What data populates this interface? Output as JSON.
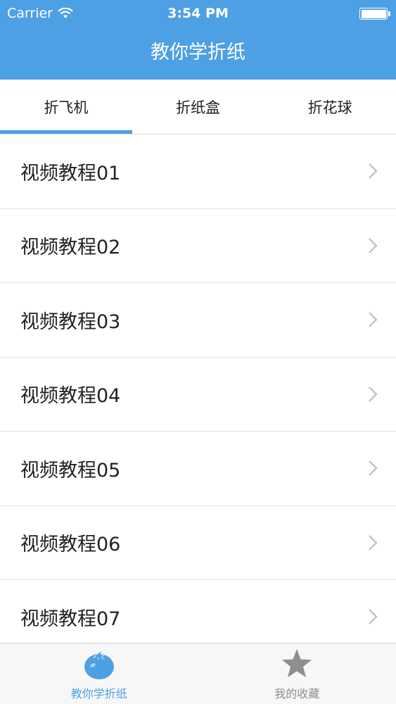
{
  "status_bar": {
    "carrier": "Carrier",
    "time": "3:54 PM"
  },
  "nav": {
    "title": "教你学折纸"
  },
  "tabs": [
    {
      "label": "折飞机",
      "selected": true
    },
    {
      "label": "折纸盒",
      "selected": false
    },
    {
      "label": "折花球",
      "selected": false
    }
  ],
  "list": {
    "items": [
      {
        "label": "视频教程01"
      },
      {
        "label": "视频教程02"
      },
      {
        "label": "视频教程03"
      },
      {
        "label": "视频教程04"
      },
      {
        "label": "视频教程05"
      },
      {
        "label": "视频教程06"
      },
      {
        "label": "视频教程07"
      }
    ]
  },
  "tabbar": {
    "items": [
      {
        "label": "教你学折纸",
        "icon": "tomato-icon",
        "active": true
      },
      {
        "label": "我的收藏",
        "icon": "star-icon",
        "active": false
      }
    ]
  },
  "colors": {
    "accent": "#4ea0e4",
    "inactive": "#8e8e8e"
  }
}
